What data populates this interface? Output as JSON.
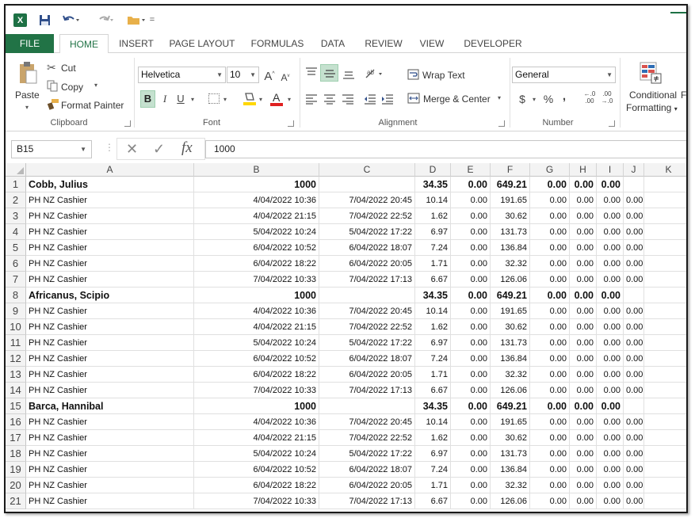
{
  "quick_access": {
    "logo": "X",
    "qat_dropdown": "="
  },
  "tabs": [
    "FILE",
    "HOME",
    "INSERT",
    "PAGE LAYOUT",
    "FORMULAS",
    "DATA",
    "REVIEW",
    "VIEW",
    "DEVELOPER"
  ],
  "clipboard": {
    "paste": "Paste",
    "cut": "Cut",
    "copy": "Copy",
    "format_painter": "Format Painter",
    "label": "Clipboard"
  },
  "font": {
    "name": "Helvetica",
    "size": "10",
    "bold": "B",
    "italic": "I",
    "underline": "U",
    "grow": "A",
    "shrink": "A",
    "font_color_letter": "A",
    "label": "Font"
  },
  "alignment": {
    "wrap_text": "Wrap Text",
    "merge_center": "Merge & Center",
    "label": "Alignment"
  },
  "number": {
    "format": "General",
    "currency": "$",
    "percent": "%",
    "comma": ",",
    "increase_decimal": "←.0\n.00",
    "decrease_decimal": ".00\n→.0",
    "label": "Number"
  },
  "styles": {
    "conditional": "Conditional",
    "formatting": "Formatting",
    "format_partial": "Fo"
  },
  "formula_bar": {
    "name_box": "B15",
    "fx": "fx",
    "value": "1000"
  },
  "colors": {
    "brand": "#217346",
    "highlight_fill": "#ffd700",
    "font_color": "#e02020"
  },
  "columns": [
    "A",
    "B",
    "C",
    "D",
    "E",
    "F",
    "G",
    "H",
    "I",
    "J",
    "K"
  ],
  "rows": [
    {
      "n": "1",
      "type": "header",
      "cells": [
        "Cobb, Julius",
        "1000",
        "",
        "34.35",
        "0.00",
        "649.21",
        "0.00",
        "0.00",
        "0.00",
        "",
        ""
      ]
    },
    {
      "n": "2",
      "type": "data",
      "cells": [
        "PH NZ Cashier",
        "4/04/2022 10:36",
        "7/04/2022 20:45",
        "10.14",
        "0.00",
        "191.65",
        "0.00",
        "0.00",
        "0.00",
        "0.00",
        ""
      ]
    },
    {
      "n": "3",
      "type": "data",
      "cells": [
        "PH NZ Cashier",
        "4/04/2022 21:15",
        "7/04/2022 22:52",
        "1.62",
        "0.00",
        "30.62",
        "0.00",
        "0.00",
        "0.00",
        "0.00",
        ""
      ]
    },
    {
      "n": "4",
      "type": "data",
      "cells": [
        "PH NZ Cashier",
        "5/04/2022 10:24",
        "5/04/2022 17:22",
        "6.97",
        "0.00",
        "131.73",
        "0.00",
        "0.00",
        "0.00",
        "0.00",
        ""
      ]
    },
    {
      "n": "5",
      "type": "data",
      "cells": [
        "PH NZ Cashier",
        "6/04/2022 10:52",
        "6/04/2022 18:07",
        "7.24",
        "0.00",
        "136.84",
        "0.00",
        "0.00",
        "0.00",
        "0.00",
        ""
      ]
    },
    {
      "n": "6",
      "type": "data",
      "cells": [
        "PH NZ Cashier",
        "6/04/2022 18:22",
        "6/04/2022 20:05",
        "1.71",
        "0.00",
        "32.32",
        "0.00",
        "0.00",
        "0.00",
        "0.00",
        ""
      ]
    },
    {
      "n": "7",
      "type": "data",
      "cells": [
        "PH NZ Cashier",
        "7/04/2022 10:33",
        "7/04/2022 17:13",
        "6.67",
        "0.00",
        "126.06",
        "0.00",
        "0.00",
        "0.00",
        "0.00",
        ""
      ]
    },
    {
      "n": "8",
      "type": "header",
      "cells": [
        "Africanus, Scipio",
        "1000",
        "",
        "34.35",
        "0.00",
        "649.21",
        "0.00",
        "0.00",
        "0.00",
        "",
        ""
      ]
    },
    {
      "n": "9",
      "type": "data",
      "cells": [
        "PH NZ Cashier",
        "4/04/2022 10:36",
        "7/04/2022 20:45",
        "10.14",
        "0.00",
        "191.65",
        "0.00",
        "0.00",
        "0.00",
        "0.00",
        ""
      ]
    },
    {
      "n": "10",
      "type": "data",
      "cells": [
        "PH NZ Cashier",
        "4/04/2022 21:15",
        "7/04/2022 22:52",
        "1.62",
        "0.00",
        "30.62",
        "0.00",
        "0.00",
        "0.00",
        "0.00",
        ""
      ]
    },
    {
      "n": "11",
      "type": "data",
      "cells": [
        "PH NZ Cashier",
        "5/04/2022 10:24",
        "5/04/2022 17:22",
        "6.97",
        "0.00",
        "131.73",
        "0.00",
        "0.00",
        "0.00",
        "0.00",
        ""
      ]
    },
    {
      "n": "12",
      "type": "data",
      "cells": [
        "PH NZ Cashier",
        "6/04/2022 10:52",
        "6/04/2022 18:07",
        "7.24",
        "0.00",
        "136.84",
        "0.00",
        "0.00",
        "0.00",
        "0.00",
        ""
      ]
    },
    {
      "n": "13",
      "type": "data",
      "cells": [
        "PH NZ Cashier",
        "6/04/2022 18:22",
        "6/04/2022 20:05",
        "1.71",
        "0.00",
        "32.32",
        "0.00",
        "0.00",
        "0.00",
        "0.00",
        ""
      ]
    },
    {
      "n": "14",
      "type": "data",
      "cells": [
        "PH NZ Cashier",
        "7/04/2022 10:33",
        "7/04/2022 17:13",
        "6.67",
        "0.00",
        "126.06",
        "0.00",
        "0.00",
        "0.00",
        "0.00",
        ""
      ]
    },
    {
      "n": "15",
      "type": "header",
      "cells": [
        "Barca, Hannibal",
        "1000",
        "",
        "34.35",
        "0.00",
        "649.21",
        "0.00",
        "0.00",
        "0.00",
        "",
        ""
      ]
    },
    {
      "n": "16",
      "type": "data",
      "cells": [
        "PH NZ Cashier",
        "4/04/2022 10:36",
        "7/04/2022 20:45",
        "10.14",
        "0.00",
        "191.65",
        "0.00",
        "0.00",
        "0.00",
        "0.00",
        ""
      ]
    },
    {
      "n": "17",
      "type": "data",
      "cells": [
        "PH NZ Cashier",
        "4/04/2022 21:15",
        "7/04/2022 22:52",
        "1.62",
        "0.00",
        "30.62",
        "0.00",
        "0.00",
        "0.00",
        "0.00",
        ""
      ]
    },
    {
      "n": "18",
      "type": "data",
      "cells": [
        "PH NZ Cashier",
        "5/04/2022 10:24",
        "5/04/2022 17:22",
        "6.97",
        "0.00",
        "131.73",
        "0.00",
        "0.00",
        "0.00",
        "0.00",
        ""
      ]
    },
    {
      "n": "19",
      "type": "data",
      "cells": [
        "PH NZ Cashier",
        "6/04/2022 10:52",
        "6/04/2022 18:07",
        "7.24",
        "0.00",
        "136.84",
        "0.00",
        "0.00",
        "0.00",
        "0.00",
        ""
      ]
    },
    {
      "n": "20",
      "type": "data",
      "cells": [
        "PH NZ Cashier",
        "6/04/2022 18:22",
        "6/04/2022 20:05",
        "1.71",
        "0.00",
        "32.32",
        "0.00",
        "0.00",
        "0.00",
        "0.00",
        ""
      ]
    },
    {
      "n": "21",
      "type": "data",
      "cells": [
        "PH NZ Cashier",
        "7/04/2022 10:33",
        "7/04/2022 17:13",
        "6.67",
        "0.00",
        "126.06",
        "0.00",
        "0.00",
        "0.00",
        "0.00",
        ""
      ]
    }
  ]
}
